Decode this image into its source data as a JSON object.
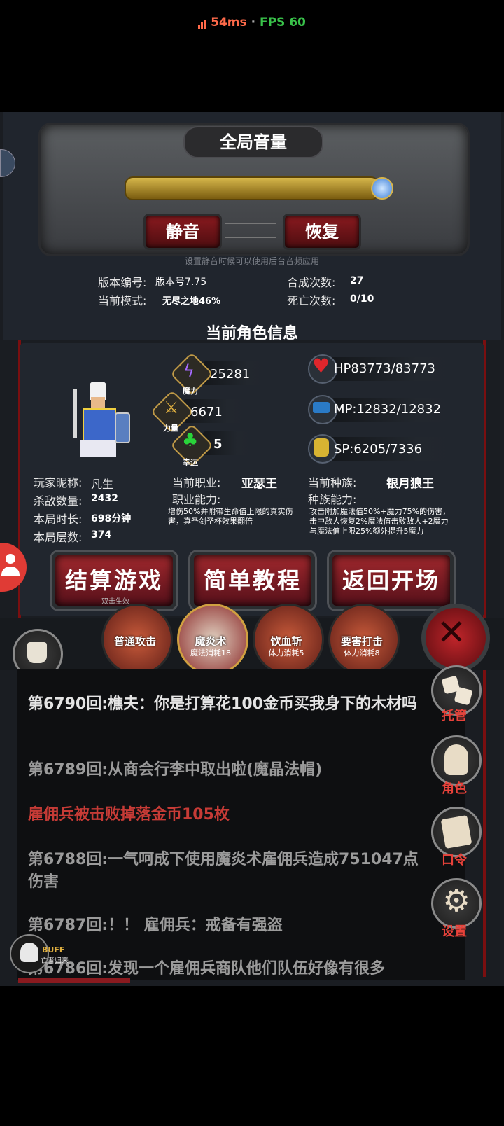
{
  "status": {
    "ping": "54ms",
    "separator": "·",
    "fps": "FPS 60"
  },
  "volume": {
    "title": "全局音量",
    "level": 1.0,
    "mute_label": "静音",
    "restore_label": "恢复",
    "hint": "设置静音时候可以使用后台音频应用"
  },
  "game_info": {
    "version_label": "版本编号:",
    "version_value": "版本号7.75",
    "mode_label": "当前模式:",
    "mode_value": "无尽之地46%",
    "craft_label": "合成次数:",
    "craft_value": "27",
    "death_label": "死亡次数:",
    "death_value": "0/10"
  },
  "character": {
    "section_title": "当前角色信息",
    "magic_value": "25281",
    "magic_label": "魔力",
    "strength_value": "6671",
    "strength_label": "力量",
    "luck_value": "5",
    "luck_label": "幸运",
    "hp": "HP83773/83773",
    "mp": "MP:12832/12832",
    "sp": "SP:6205/7336",
    "nickname_label": "玩家昵称:",
    "nickname_value": "凡生",
    "kills_label": "杀敌数量:",
    "kills_value": "2432",
    "time_label": "本局时长:",
    "time_value": "698分钟",
    "floor_label": "本局层数:",
    "floor_value": "374",
    "class_label": "当前职业:",
    "class_value": "亚瑟王",
    "class_ability_label": "职业能力:",
    "class_ability_text": "增伤50%并附带生命值上限的真实伤害，真圣剑圣杯效果翻倍",
    "race_label": "当前种族:",
    "race_value": "银月狼王",
    "race_ability_label": "种族能力:",
    "race_ability_text": "攻击附加魔法值50%+魔力75%的伤害，击中敌人恢复2%魔法值击败敌人+2魔力与魔法值上限25%额外提升5魔力"
  },
  "actions": {
    "settle_label": "结算游戏",
    "settle_hint": "双击生效",
    "tutorial_label": "简单教程",
    "return_label": "返回开场"
  },
  "skills": [
    {
      "name": "普通攻击",
      "cost": ""
    },
    {
      "name": "魔炎术",
      "cost": "魔法消耗18"
    },
    {
      "name": "饮血斩",
      "cost": "体力消耗5"
    },
    {
      "name": "要害打击",
      "cost": "体力消耗8"
    }
  ],
  "shop_label": "商铺",
  "side_buttons": [
    {
      "label": "托管",
      "icon": "dice-icon"
    },
    {
      "label": "角色",
      "icon": "hooded-figure-icon"
    },
    {
      "label": "口令",
      "icon": "scroll-icon"
    },
    {
      "label": "设置",
      "icon": "gear-icon"
    }
  ],
  "log": [
    {
      "text": "第6790回:樵夫：你是打算花100金币买我身下的木材吗",
      "style": "white"
    },
    {
      "text": "第6789回:从商会行李中取出啦(魔晶法帽)",
      "style": "grey"
    },
    {
      "text": "雇佣兵被击败掉落金币105枚",
      "style": "red"
    },
    {
      "text": "第6788回:一气呵成下使用魔炎术雇佣兵造成751047点伤害",
      "style": "grey"
    },
    {
      "text": "第6787回:！！ 雇佣兵：戒备有强盗",
      "style": "grey"
    },
    {
      "text": "第6786回:发现一个雇佣兵商队他们队伍好像有很多",
      "style": "grey"
    }
  ],
  "buff": {
    "label": "BUFF",
    "sub": "亡者归来"
  },
  "colors": {
    "accent_red": "#8a1a1f",
    "gold": "#c09a47",
    "log_red": "#c63b36"
  }
}
